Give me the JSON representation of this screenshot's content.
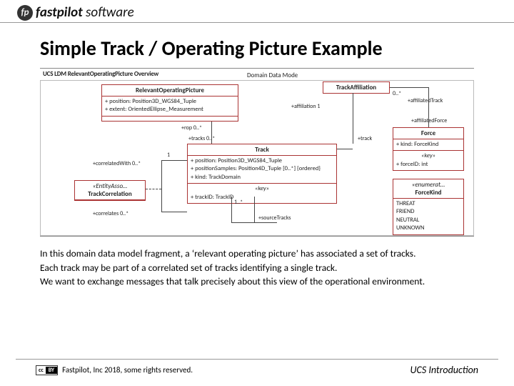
{
  "logo": {
    "icon_text": "fp",
    "brand_bold": "fastpilot",
    "brand_light": " software"
  },
  "title": "Simple Track / Operating Picture Example",
  "diagram": {
    "header": "UCS LDM RelevantOperatingPicture Overview",
    "caption": "Domain Data Mode",
    "classes": {
      "rop": {
        "name": "RelevantOperatingPicture",
        "attrs": [
          "+  position: Position3D_WGS84_Tuple",
          "+  extent: OrientedEllipse_Measurement"
        ]
      },
      "taff": {
        "name": "TrackAffiliation"
      },
      "track": {
        "name": "Track",
        "attrs": [
          "+  position: Position3D_WGS84_Tuple",
          "+  positionSamples: Position4D_Tuple [0..*] {ordered}",
          "+  kind: TrackDomain"
        ],
        "key_label": "«key»",
        "key": "+  trackID: TrackID"
      },
      "force": {
        "name": "Force",
        "attrs": [
          "+  kind: ForceKind"
        ],
        "key_label": "«key»",
        "key": "+  forceID: int"
      },
      "enum": {
        "stereo": "«enumerat…",
        "name": "ForceKind",
        "literals": [
          "THREAT",
          "FRIEND",
          "NEUTRAL",
          "UNKNOWN"
        ]
      },
      "assoc": {
        "stereo": "«EntityAsso…",
        "name": "TrackCorrelation"
      }
    },
    "roles": {
      "rop_tracks": "+rop   0..*",
      "tracks": "+tracks   0..*",
      "affiliation": "+affiliation   1",
      "aff_track_mult": "0..*",
      "aff_track": "+affiliatedTrack",
      "aff_force": "+affiliatedForce",
      "track_side": "+track",
      "track_one": "1",
      "correlatedWith": "+correlatedWith   0..*",
      "correlates": "+correlates   0..*",
      "sourceTracks_mult": "1..*",
      "sourceTracks": "+sourceTracks"
    }
  },
  "description": {
    "p1": "In this domain data model fragment, a ‘relevant operating picture’ has associated a set of tracks.",
    "p2": "Each track may be part of a correlated set of tracks identifying a single track.",
    "p3": "We want to exchange messages that talk precisely about this view of the operational environment."
  },
  "footer": {
    "cc_left": "cc",
    "cc_right": "BY",
    "copyright": "Fastpilot, Inc 2018, some rights reserved.",
    "slide_label": "UCS Introduction"
  }
}
